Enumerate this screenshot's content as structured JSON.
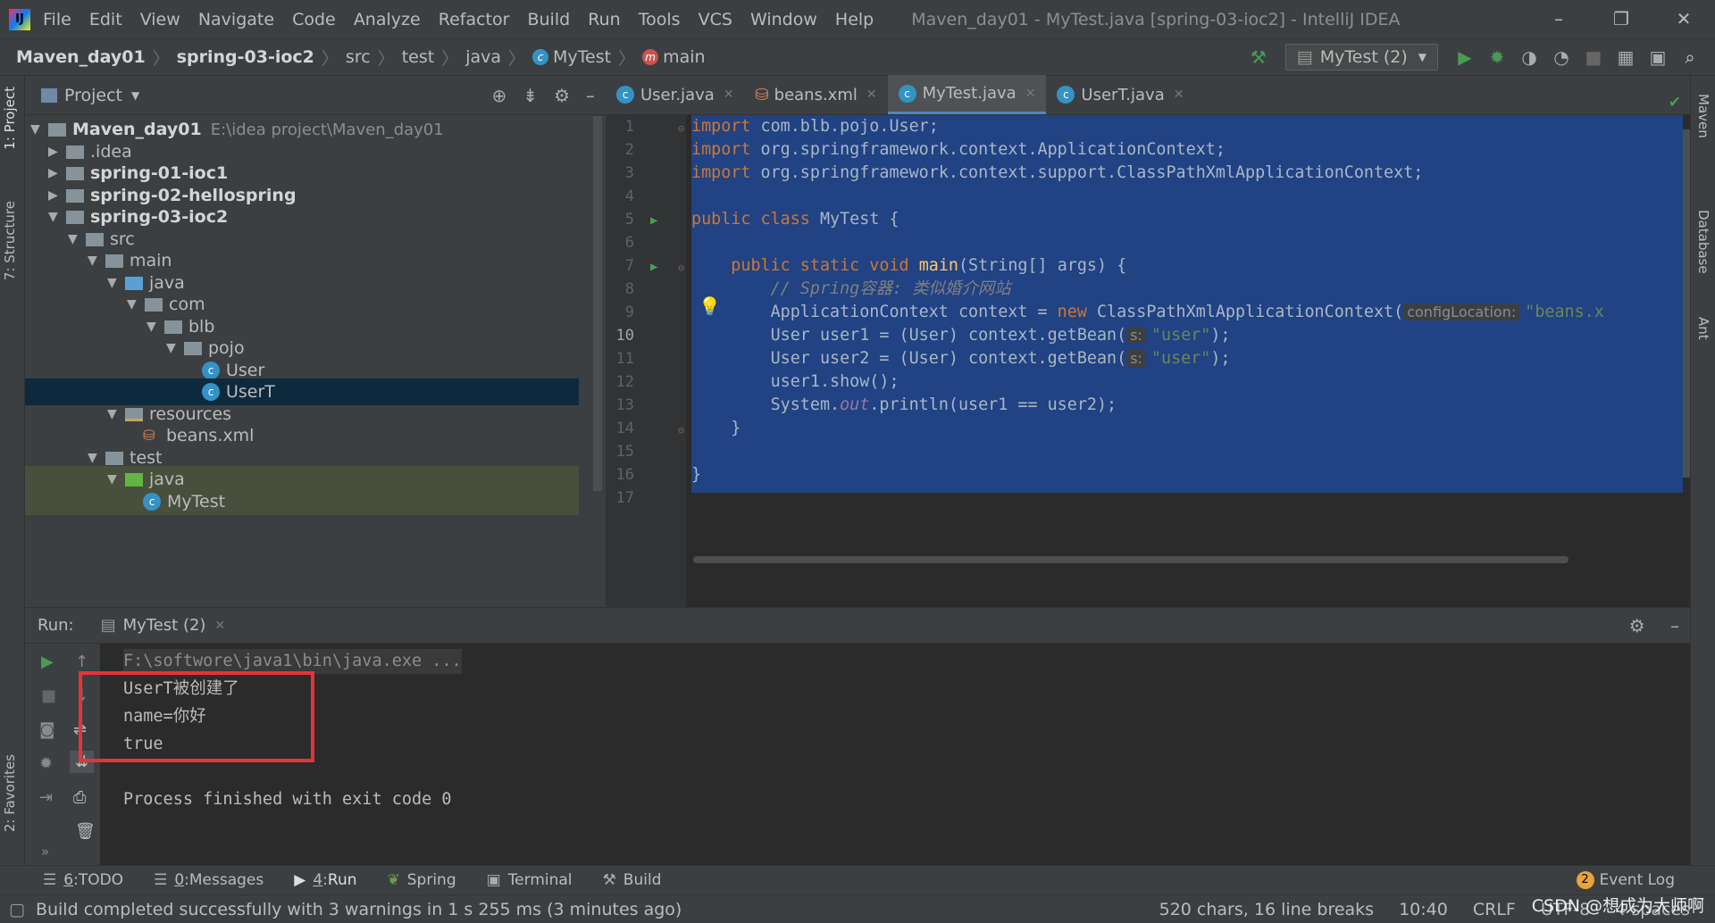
{
  "titlebar": {
    "menus": [
      "File",
      "Edit",
      "View",
      "Navigate",
      "Code",
      "Analyze",
      "Refactor",
      "Build",
      "Run",
      "Tools",
      "VCS",
      "Window",
      "Help"
    ],
    "title": "Maven_day01 - MyTest.java [spring-03-ioc2] - IntelliJ IDEA"
  },
  "navbar": {
    "crumbs": [
      "Maven_day01",
      "spring-03-ioc2",
      "src",
      "test",
      "java",
      "MyTest",
      "main"
    ],
    "run_config": "MyTest (2)"
  },
  "project": {
    "title": "Project",
    "tree": [
      {
        "label": "Maven_day01",
        "path": "E:\\idea project\\Maven_day01"
      },
      {
        "label": ".idea"
      },
      {
        "label": "spring-01-ioc1"
      },
      {
        "label": "spring-02-hellospring"
      },
      {
        "label": "spring-03-ioc2"
      },
      {
        "label": "src"
      },
      {
        "label": "main"
      },
      {
        "label": "java"
      },
      {
        "label": "com"
      },
      {
        "label": "blb"
      },
      {
        "label": "pojo"
      },
      {
        "label": "User"
      },
      {
        "label": "UserT"
      },
      {
        "label": "resources"
      },
      {
        "label": "beans.xml"
      },
      {
        "label": "test"
      },
      {
        "label": "java"
      },
      {
        "label": "MyTest"
      }
    ]
  },
  "side_tabs": {
    "left": [
      "1: Project",
      "7: Structure",
      "2: Favorites"
    ],
    "right": [
      "Maven",
      "Database",
      "Ant"
    ]
  },
  "editor": {
    "tabs": [
      "User.java",
      "beans.xml",
      "MyTest.java",
      "UserT.java"
    ],
    "line_numbers": [
      "1",
      "2",
      "3",
      "4",
      "5",
      "6",
      "7",
      "8",
      "9",
      "10",
      "11",
      "12",
      "13",
      "14",
      "15",
      "16",
      "17"
    ],
    "code": {
      "l1": "com.blb.pojo.User;",
      "l2": "org.springframework.context.ApplicationContext;",
      "l3": "org.springframework.context.support.ClassPathXmlApplicationContext;",
      "l5": "MyTest {",
      "l7_sig": "(String[] args) {",
      "l8": "// Spring容器: 类似婚介网站",
      "l9a": "ApplicationContext context = ",
      "l9b": "ClassPathXmlApplicationContext(",
      "l9_hint": "configLocation:",
      "l9_str": "\"beans.x",
      "l10": "User user1 = (User) context.getBean(",
      "l11": "User user2 = (User) context.getBean(",
      "hint_s": "s:",
      "str_user": "\"user\"",
      "close_paren": ");",
      "l12": "user1.show();",
      "l13a": "System.",
      "l13b": "out",
      "l13c": ".println(user1 == user2);",
      "brace": "}",
      "kw_import": "import",
      "kw_public_class": "public class",
      "kw_public_static_void": "public static void",
      "fn_main": "main",
      "kw_new": "new"
    }
  },
  "run": {
    "label": "Run:",
    "tab": "MyTest (2)",
    "console": [
      "F:\\softwore\\java1\\bin\\java.exe ...",
      "UserT被创建了",
      "name=你好",
      "true",
      "",
      "Process finished with exit code 0"
    ]
  },
  "bottom_tabs": [
    {
      "num": "6",
      "label": "TODO"
    },
    {
      "num": "0",
      "label": "Messages"
    },
    {
      "num": "4",
      "label": "Run"
    },
    {
      "num": "",
      "label": "Spring"
    },
    {
      "num": "",
      "label": "Terminal"
    },
    {
      "num": "",
      "label": "Build"
    }
  ],
  "event_log": {
    "count": "2",
    "label": "Event Log"
  },
  "status": {
    "message": "Build completed successfully with 3 warnings in 1 s 255 ms (3 minutes ago)",
    "chars": "520 chars, 16 line breaks",
    "position": "10:40",
    "line_sep": "CRLF",
    "encoding": "UTF-8",
    "indent": "4 spaces"
  },
  "watermark": "CSDN @想成为大师啊"
}
